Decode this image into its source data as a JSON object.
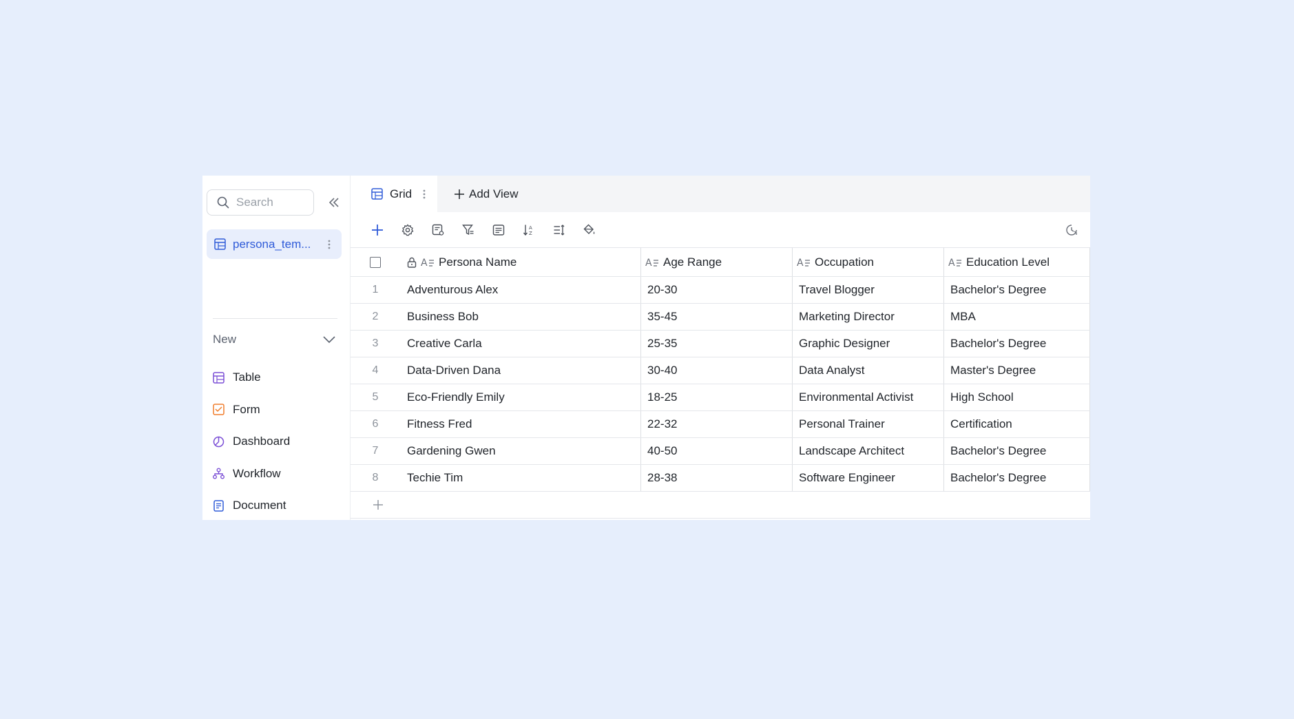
{
  "sidebar": {
    "search_placeholder": "Search",
    "table_item": {
      "label": "persona_tem...",
      "icon": "table-icon"
    },
    "new_label": "New",
    "new_items": [
      {
        "label": "Table",
        "icon": "table-icon",
        "color": "#7b4fd6"
      },
      {
        "label": "Form",
        "icon": "form-icon",
        "color": "#f07d2b"
      },
      {
        "label": "Dashboard",
        "icon": "dashboard-icon",
        "color": "#7b4fd6"
      },
      {
        "label": "Workflow",
        "icon": "workflow-icon",
        "color": "#7b4fd6"
      },
      {
        "label": "Document",
        "icon": "document-icon",
        "color": "#2f5bd8"
      }
    ]
  },
  "tabs": {
    "active": "Grid",
    "add_view": "Add View"
  },
  "toolbar": {
    "icons": [
      "add-record-icon",
      "settings-icon",
      "field-config-icon",
      "filter-icon",
      "group-icon",
      "sort-icon",
      "row-height-icon",
      "fill-color-icon"
    ],
    "right_icon": "history-icon"
  },
  "grid": {
    "columns": [
      "Persona Name",
      "Age Range",
      "Occupation",
      "Education Level"
    ],
    "rows": [
      {
        "num": "1",
        "name": "Adventurous Alex",
        "age": "20-30",
        "occupation": "Travel Blogger",
        "education": "Bachelor's Degree"
      },
      {
        "num": "2",
        "name": "Business Bob",
        "age": "35-45",
        "occupation": "Marketing Director",
        "education": "MBA"
      },
      {
        "num": "3",
        "name": "Creative Carla",
        "age": "25-35",
        "occupation": "Graphic Designer",
        "education": "Bachelor's Degree"
      },
      {
        "num": "4",
        "name": "Data-Driven Dana",
        "age": "30-40",
        "occupation": "Data Analyst",
        "education": "Master's Degree"
      },
      {
        "num": "5",
        "name": "Eco-Friendly Emily",
        "age": "18-25",
        "occupation": "Environmental Activist",
        "education": "High School"
      },
      {
        "num": "6",
        "name": "Fitness Fred",
        "age": "22-32",
        "occupation": "Personal Trainer",
        "education": "Certification"
      },
      {
        "num": "7",
        "name": "Gardening Gwen",
        "age": "40-50",
        "occupation": "Landscape Architect",
        "education": "Bachelor's Degree"
      },
      {
        "num": "8",
        "name": "Techie Tim",
        "age": "28-38",
        "occupation": "Software Engineer",
        "education": "Bachelor's Degree"
      }
    ]
  },
  "colors": {
    "background": "#e6eefc",
    "accent": "#2f5bd8",
    "selected_bg": "#e8eefc"
  }
}
